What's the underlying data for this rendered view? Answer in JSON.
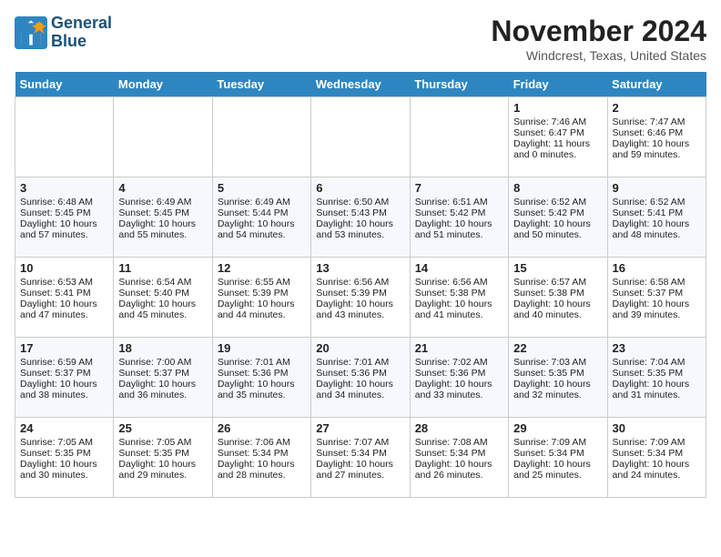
{
  "header": {
    "logo_line1": "General",
    "logo_line2": "Blue",
    "month": "November 2024",
    "location": "Windcrest, Texas, United States"
  },
  "weekdays": [
    "Sunday",
    "Monday",
    "Tuesday",
    "Wednesday",
    "Thursday",
    "Friday",
    "Saturday"
  ],
  "weeks": [
    [
      {
        "day": "",
        "info": ""
      },
      {
        "day": "",
        "info": ""
      },
      {
        "day": "",
        "info": ""
      },
      {
        "day": "",
        "info": ""
      },
      {
        "day": "",
        "info": ""
      },
      {
        "day": "1",
        "info": "Sunrise: 7:46 AM\nSunset: 6:47 PM\nDaylight: 11 hours\nand 0 minutes."
      },
      {
        "day": "2",
        "info": "Sunrise: 7:47 AM\nSunset: 6:46 PM\nDaylight: 10 hours\nand 59 minutes."
      }
    ],
    [
      {
        "day": "3",
        "info": "Sunrise: 6:48 AM\nSunset: 5:45 PM\nDaylight: 10 hours\nand 57 minutes."
      },
      {
        "day": "4",
        "info": "Sunrise: 6:49 AM\nSunset: 5:45 PM\nDaylight: 10 hours\nand 55 minutes."
      },
      {
        "day": "5",
        "info": "Sunrise: 6:49 AM\nSunset: 5:44 PM\nDaylight: 10 hours\nand 54 minutes."
      },
      {
        "day": "6",
        "info": "Sunrise: 6:50 AM\nSunset: 5:43 PM\nDaylight: 10 hours\nand 53 minutes."
      },
      {
        "day": "7",
        "info": "Sunrise: 6:51 AM\nSunset: 5:42 PM\nDaylight: 10 hours\nand 51 minutes."
      },
      {
        "day": "8",
        "info": "Sunrise: 6:52 AM\nSunset: 5:42 PM\nDaylight: 10 hours\nand 50 minutes."
      },
      {
        "day": "9",
        "info": "Sunrise: 6:52 AM\nSunset: 5:41 PM\nDaylight: 10 hours\nand 48 minutes."
      }
    ],
    [
      {
        "day": "10",
        "info": "Sunrise: 6:53 AM\nSunset: 5:41 PM\nDaylight: 10 hours\nand 47 minutes."
      },
      {
        "day": "11",
        "info": "Sunrise: 6:54 AM\nSunset: 5:40 PM\nDaylight: 10 hours\nand 45 minutes."
      },
      {
        "day": "12",
        "info": "Sunrise: 6:55 AM\nSunset: 5:39 PM\nDaylight: 10 hours\nand 44 minutes."
      },
      {
        "day": "13",
        "info": "Sunrise: 6:56 AM\nSunset: 5:39 PM\nDaylight: 10 hours\nand 43 minutes."
      },
      {
        "day": "14",
        "info": "Sunrise: 6:56 AM\nSunset: 5:38 PM\nDaylight: 10 hours\nand 41 minutes."
      },
      {
        "day": "15",
        "info": "Sunrise: 6:57 AM\nSunset: 5:38 PM\nDaylight: 10 hours\nand 40 minutes."
      },
      {
        "day": "16",
        "info": "Sunrise: 6:58 AM\nSunset: 5:37 PM\nDaylight: 10 hours\nand 39 minutes."
      }
    ],
    [
      {
        "day": "17",
        "info": "Sunrise: 6:59 AM\nSunset: 5:37 PM\nDaylight: 10 hours\nand 38 minutes."
      },
      {
        "day": "18",
        "info": "Sunrise: 7:00 AM\nSunset: 5:37 PM\nDaylight: 10 hours\nand 36 minutes."
      },
      {
        "day": "19",
        "info": "Sunrise: 7:01 AM\nSunset: 5:36 PM\nDaylight: 10 hours\nand 35 minutes."
      },
      {
        "day": "20",
        "info": "Sunrise: 7:01 AM\nSunset: 5:36 PM\nDaylight: 10 hours\nand 34 minutes."
      },
      {
        "day": "21",
        "info": "Sunrise: 7:02 AM\nSunset: 5:36 PM\nDaylight: 10 hours\nand 33 minutes."
      },
      {
        "day": "22",
        "info": "Sunrise: 7:03 AM\nSunset: 5:35 PM\nDaylight: 10 hours\nand 32 minutes."
      },
      {
        "day": "23",
        "info": "Sunrise: 7:04 AM\nSunset: 5:35 PM\nDaylight: 10 hours\nand 31 minutes."
      }
    ],
    [
      {
        "day": "24",
        "info": "Sunrise: 7:05 AM\nSunset: 5:35 PM\nDaylight: 10 hours\nand 30 minutes."
      },
      {
        "day": "25",
        "info": "Sunrise: 7:05 AM\nSunset: 5:35 PM\nDaylight: 10 hours\nand 29 minutes."
      },
      {
        "day": "26",
        "info": "Sunrise: 7:06 AM\nSunset: 5:34 PM\nDaylight: 10 hours\nand 28 minutes."
      },
      {
        "day": "27",
        "info": "Sunrise: 7:07 AM\nSunset: 5:34 PM\nDaylight: 10 hours\nand 27 minutes."
      },
      {
        "day": "28",
        "info": "Sunrise: 7:08 AM\nSunset: 5:34 PM\nDaylight: 10 hours\nand 26 minutes."
      },
      {
        "day": "29",
        "info": "Sunrise: 7:09 AM\nSunset: 5:34 PM\nDaylight: 10 hours\nand 25 minutes."
      },
      {
        "day": "30",
        "info": "Sunrise: 7:09 AM\nSunset: 5:34 PM\nDaylight: 10 hours\nand 24 minutes."
      }
    ]
  ]
}
